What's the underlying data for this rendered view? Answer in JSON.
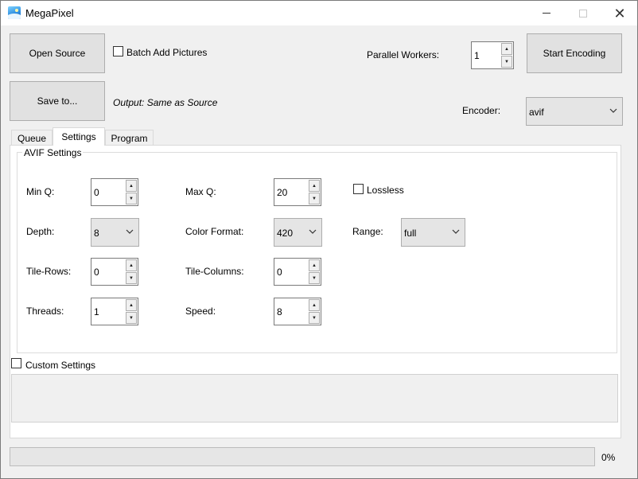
{
  "window": {
    "title": "MegaPixel",
    "minimize_icon": "minimize-icon",
    "maximize_icon": "maximize-icon",
    "close_icon": "close-icon",
    "close_glyph": "✕"
  },
  "toolbar": {
    "open_source_label": "Open Source",
    "batch_add_label": "Batch Add Pictures",
    "batch_add_checked": false,
    "parallel_workers_label": "Parallel Workers:",
    "parallel_workers_value": "1",
    "start_encoding_label": "Start Encoding",
    "save_to_label": "Save to...",
    "output_text": "Output: Same as Source",
    "encoder_label": "Encoder:",
    "encoder_value": "avif"
  },
  "tabs": [
    "Queue",
    "Settings",
    "Program"
  ],
  "active_tab": "Settings",
  "avif_settings": {
    "group_title": "AVIF Settings",
    "min_q_label": "Min Q:",
    "min_q_value": "0",
    "max_q_label": "Max Q:",
    "max_q_value": "20",
    "lossless_label": "Lossless",
    "lossless_checked": false,
    "depth_label": "Depth:",
    "depth_value": "8",
    "color_format_label": "Color Format:",
    "color_format_value": "420",
    "range_label": "Range:",
    "range_value": "full",
    "tile_rows_label": "Tile-Rows:",
    "tile_rows_value": "0",
    "tile_columns_label": "Tile-Columns:",
    "tile_columns_value": "0",
    "threads_label": "Threads:",
    "threads_value": "1",
    "speed_label": "Speed:",
    "speed_value": "8"
  },
  "custom_settings": {
    "label": "Custom Settings",
    "checked": false,
    "value": ""
  },
  "progress": {
    "percent": 0,
    "text": "0%"
  },
  "glyphs": {
    "spin_up": "▲",
    "spin_down": "▼"
  }
}
